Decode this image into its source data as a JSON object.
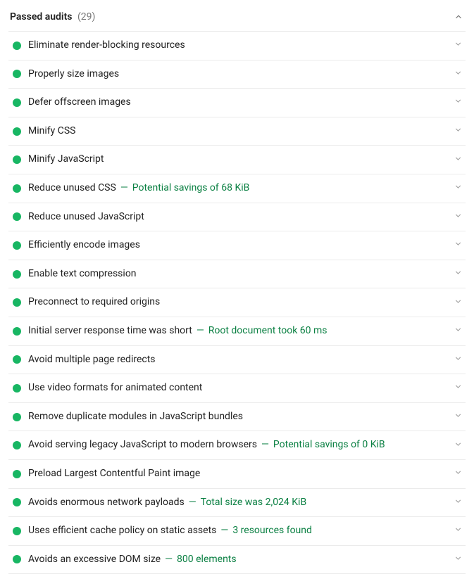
{
  "section": {
    "title": "Passed audits",
    "count": "(29)"
  },
  "audits": [
    {
      "title": "Eliminate render-blocking resources",
      "detail": ""
    },
    {
      "title": "Properly size images",
      "detail": ""
    },
    {
      "title": "Defer offscreen images",
      "detail": ""
    },
    {
      "title": "Minify CSS",
      "detail": ""
    },
    {
      "title": "Minify JavaScript",
      "detail": ""
    },
    {
      "title": "Reduce unused CSS",
      "detail": "Potential savings of 68 KiB"
    },
    {
      "title": "Reduce unused JavaScript",
      "detail": ""
    },
    {
      "title": "Efficiently encode images",
      "detail": ""
    },
    {
      "title": "Enable text compression",
      "detail": ""
    },
    {
      "title": "Preconnect to required origins",
      "detail": ""
    },
    {
      "title": "Initial server response time was short",
      "detail": "Root document took 60 ms"
    },
    {
      "title": "Avoid multiple page redirects",
      "detail": ""
    },
    {
      "title": "Use video formats for animated content",
      "detail": ""
    },
    {
      "title": "Remove duplicate modules in JavaScript bundles",
      "detail": ""
    },
    {
      "title": "Avoid serving legacy JavaScript to modern browsers",
      "detail": "Potential savings of 0 KiB"
    },
    {
      "title": "Preload Largest Contentful Paint image",
      "detail": ""
    },
    {
      "title": "Avoids enormous network payloads",
      "detail": "Total size was 2,024 KiB"
    },
    {
      "title": "Uses efficient cache policy on static assets",
      "detail": "3 resources found"
    },
    {
      "title": "Avoids an excessive DOM size",
      "detail": "800 elements"
    }
  ],
  "separator": "—"
}
